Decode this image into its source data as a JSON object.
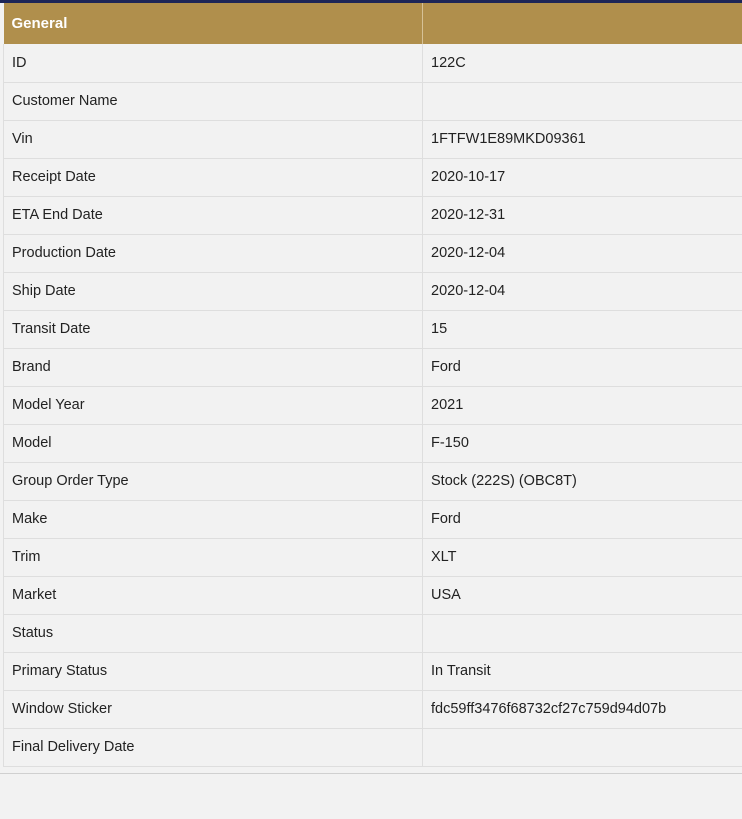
{
  "table": {
    "header": {
      "label": "General",
      "value": ""
    },
    "rows": [
      {
        "label": "ID",
        "value": "122C"
      },
      {
        "label": "Customer Name",
        "value": ""
      },
      {
        "label": "Vin",
        "value": "1FTFW1E89MKD09361"
      },
      {
        "label": "Receipt Date",
        "value": "2020-10-17"
      },
      {
        "label": "ETA End Date",
        "value": "2020-12-31"
      },
      {
        "label": "Production Date",
        "value": "2020-12-04"
      },
      {
        "label": "Ship Date",
        "value": "2020-12-04"
      },
      {
        "label": "Transit Date",
        "value": "15"
      },
      {
        "label": "Brand",
        "value": "Ford"
      },
      {
        "label": "Model Year",
        "value": "2021"
      },
      {
        "label": "Model",
        "value": "F-150"
      },
      {
        "label": "Group Order Type",
        "value": "Stock (222S) (OBC8T)"
      },
      {
        "label": "Make",
        "value": "Ford"
      },
      {
        "label": "Trim",
        "value": "XLT"
      },
      {
        "label": "Market",
        "value": "USA"
      },
      {
        "label": "Status",
        "value": ""
      },
      {
        "label": "Primary Status",
        "value": "In Transit"
      },
      {
        "label": "Window Sticker",
        "value": "fdc59ff3476f68732cf27c759d94d07b"
      },
      {
        "label": "Final Delivery Date",
        "value": ""
      }
    ]
  },
  "colors": {
    "header_bg": "#b08f4c",
    "top_bar": "#1c2557",
    "page_bg": "#f2f2f2"
  }
}
